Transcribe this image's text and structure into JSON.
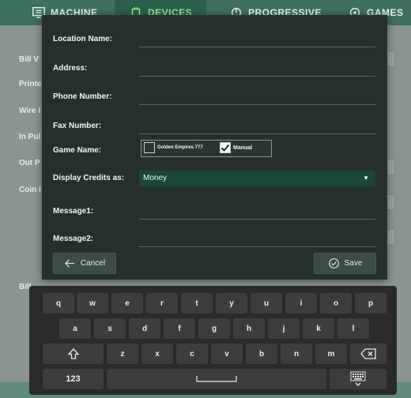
{
  "tabs": [
    {
      "label": "MACHINE",
      "icon": "monitor-icon"
    },
    {
      "label": "DEVICES",
      "icon": "chip-icon"
    },
    {
      "label": "PROGRESSIVE",
      "icon": "progressive-icon"
    },
    {
      "label": "GAMES",
      "icon": "games-icon"
    }
  ],
  "background": {
    "labels": [
      "Bill V",
      "Printe",
      "Wire I",
      "In Pul",
      "Out P",
      "Coin I",
      "Bill"
    ]
  },
  "form": {
    "location_name_label": "Location Name:",
    "address_label": "Address:",
    "phone_label": "Phone Number:",
    "fax_label": "Fax Number:",
    "game_name_label": "Game Name:",
    "game_options": [
      {
        "label": "Golden Empires 777",
        "checked": false
      },
      {
        "label": "Manual",
        "checked": true
      }
    ],
    "display_credits_label": "Display Credits as:",
    "display_credits_value": "Money",
    "message1_label": "Message1:",
    "message2_label": "Message2:",
    "cancel_label": "Cancel",
    "save_label": "Save"
  },
  "keyboard": {
    "row1": [
      "q",
      "w",
      "e",
      "r",
      "t",
      "y",
      "u",
      "i",
      "o",
      "p"
    ],
    "row2": [
      "a",
      "s",
      "d",
      "f",
      "g",
      "h",
      "j",
      "k",
      "l"
    ],
    "row3": [
      "z",
      "x",
      "c",
      "v",
      "b",
      "n",
      "m"
    ],
    "numbers_label": "123"
  },
  "colors": {
    "tab_bar": "#3f6f5f",
    "tab_active_text": "#9be38f",
    "modal_bg": "#25302c",
    "select_bg": "#1a4738",
    "keyboard_bg": "#2a2a2b",
    "key_bg": "#3d3d3f"
  }
}
